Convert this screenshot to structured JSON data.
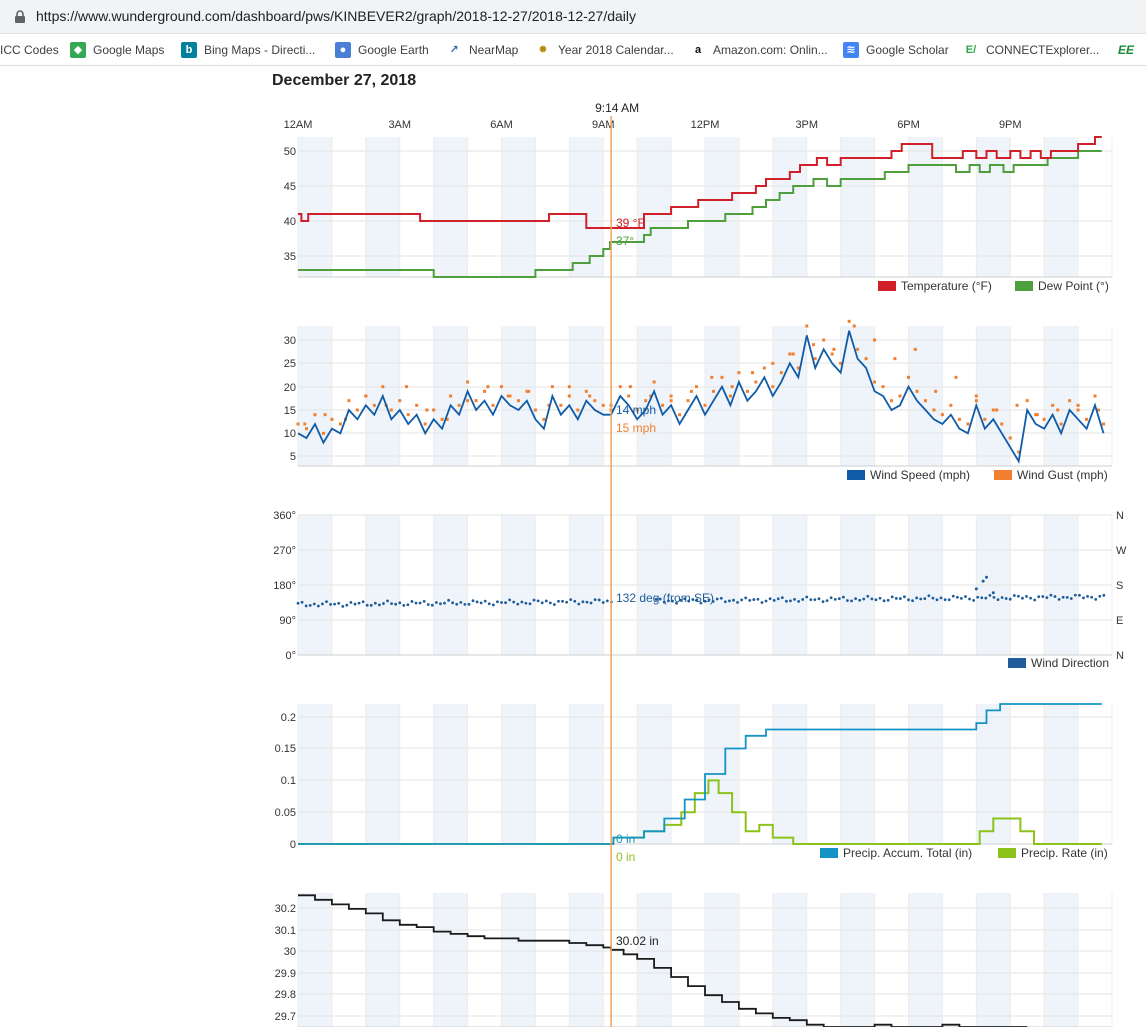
{
  "browser": {
    "url": "https://www.wunderground.com/dashboard/pws/KINBEVER2/graph/2018-12-27/2018-12-27/daily",
    "bookmarks": [
      {
        "label": "ICC Codes",
        "icon": "folder-icon"
      },
      {
        "label": "Google Maps",
        "icon": "google-maps-icon"
      },
      {
        "label": "Bing Maps - Directi...",
        "icon": "bing-icon"
      },
      {
        "label": "Google Earth",
        "icon": "google-earth-icon"
      },
      {
        "label": "NearMap",
        "icon": "nearmap-icon"
      },
      {
        "label": "Year 2018 Calendar...",
        "icon": "calendar-icon"
      },
      {
        "label": "Amazon.com: Onlin...",
        "icon": "amazon-icon"
      },
      {
        "label": "Google Scholar",
        "icon": "google-scholar-icon"
      },
      {
        "label": "CONNECTExplorer...",
        "icon": "connect-icon"
      },
      {
        "label": "EE",
        "icon": "ee-icon"
      }
    ]
  },
  "page": {
    "title": "December 27, 2018"
  },
  "cursor": {
    "label": "9:14 AM",
    "hour": 9.233
  },
  "xaxis": {
    "ticks": [
      "12AM",
      "3AM",
      "6AM",
      "9AM",
      "12PM",
      "3PM",
      "6PM",
      "9PM"
    ]
  },
  "colors": {
    "temperature": "#d0202a",
    "dewpoint": "#4fa03c",
    "wind_speed": "#0f5ba7",
    "wind_gust": "#f07f2f",
    "wind_dir": "#1f5c99",
    "accum": "#1494c6",
    "rate": "#8cc21a",
    "pressure": "#1a1a1a",
    "cursor": "#f0a35c"
  },
  "chart_data": [
    {
      "type": "line",
      "ylim": [
        32,
        52
      ],
      "yticks": [
        "50",
        "45",
        "40",
        "35"
      ],
      "series": [
        {
          "name": "Temperature (°F)",
          "x": [
            0,
            0.1,
            0.3,
            3.5,
            3.6,
            7.2,
            7.4,
            8.4,
            8.5,
            9.2,
            10.2,
            10.3,
            11,
            11.6,
            11.8,
            12.6,
            12.8,
            13.1,
            13.5,
            13.8,
            14.2,
            14.5,
            14.8,
            15.1,
            15.3,
            15.6,
            16,
            16.6,
            17.2,
            17.5,
            17.8,
            18.4,
            18.7,
            19.2,
            19.6,
            20,
            20.3,
            20.6,
            21,
            21.3,
            21.6,
            21.9,
            22.2,
            22.6,
            23,
            23.3,
            23.5,
            23.7
          ],
          "y": [
            41,
            40,
            41,
            41,
            40,
            40,
            41,
            41,
            39,
            39,
            41,
            41,
            42,
            42,
            43,
            43,
            44,
            44,
            45,
            46,
            46,
            47,
            48,
            48,
            49,
            48,
            49,
            49,
            49,
            50,
            51,
            51,
            49,
            49,
            50,
            49,
            50,
            49,
            50,
            49,
            50,
            49,
            50,
            50,
            51,
            51,
            52,
            52
          ],
          "current_label": "39 °F"
        },
        {
          "name": "Dew Point (°)",
          "x": [
            0,
            3.9,
            4.0,
            6.8,
            7.0,
            8.0,
            8.1,
            8.4,
            8.6,
            9.0,
            9.2,
            10.2,
            10.4,
            11,
            11.5,
            12.4,
            12.6,
            13.1,
            13.4,
            13.8,
            14.2,
            14.6,
            14.8,
            15.2,
            15.6,
            16,
            16.5,
            17.0,
            17.3,
            17.6,
            18.0,
            18.7,
            19.4,
            19.6,
            19.8,
            20.1,
            20.4,
            20.8,
            21.1,
            21.6,
            22.1,
            22.6,
            23,
            23.3,
            23.7
          ],
          "y": [
            33,
            33,
            32,
            32,
            33,
            33,
            34,
            34,
            35,
            36,
            37,
            38,
            39,
            39,
            40,
            40,
            41,
            41,
            42,
            43,
            44,
            45,
            45,
            46,
            45,
            46,
            46,
            46,
            47,
            47,
            48,
            48,
            47,
            47,
            48,
            47,
            48,
            47,
            48,
            48,
            49,
            49,
            50,
            50,
            50
          ],
          "current_label": "37°"
        }
      ]
    },
    {
      "type": "line",
      "ylim": [
        3,
        33
      ],
      "yticks": [
        "30",
        "25",
        "20",
        "15",
        "10",
        "5"
      ],
      "series": [
        {
          "name": "Wind Speed (mph)",
          "x": [
            0,
            0.25,
            0.5,
            0.75,
            1,
            1.25,
            1.5,
            1.75,
            2,
            2.25,
            2.5,
            2.75,
            3,
            3.25,
            3.5,
            3.75,
            4,
            4.25,
            4.5,
            4.75,
            5,
            5.25,
            5.5,
            5.75,
            6,
            6.25,
            6.5,
            6.75,
            7,
            7.25,
            7.5,
            7.75,
            8,
            8.25,
            8.5,
            8.75,
            9,
            9.23,
            9.5,
            9.75,
            10,
            10.25,
            10.5,
            10.75,
            11,
            11.25,
            11.5,
            11.75,
            12,
            12.25,
            12.5,
            12.75,
            13,
            13.25,
            13.5,
            13.75,
            14,
            14.25,
            14.5,
            14.75,
            15,
            15.25,
            15.5,
            15.75,
            16,
            16.25,
            16.5,
            16.75,
            17,
            17.25,
            17.5,
            17.75,
            18,
            18.25,
            18.5,
            18.75,
            19,
            19.25,
            19.5,
            19.75,
            20,
            20.25,
            20.5,
            20.75,
            21,
            21.25,
            21.5,
            21.75,
            22,
            22.25,
            22.5,
            22.75,
            23,
            23.25,
            23.5,
            23.75
          ],
          "y": [
            10,
            9,
            12,
            8,
            11,
            10,
            15,
            13,
            16,
            14,
            18,
            13,
            15,
            12,
            14,
            10,
            13,
            11,
            16,
            14,
            19,
            15,
            17,
            14,
            18,
            16,
            15,
            17,
            13,
            11,
            18,
            14,
            16,
            13,
            17,
            15,
            14,
            14,
            18,
            16,
            13,
            15,
            19,
            14,
            16,
            12,
            15,
            18,
            14,
            17,
            20,
            16,
            21,
            17,
            19,
            22,
            18,
            21,
            25,
            22,
            31,
            24,
            28,
            25,
            23,
            32,
            26,
            24,
            19,
            18,
            15,
            16,
            20,
            17,
            15,
            13,
            12,
            14,
            11,
            10,
            16,
            11,
            13,
            10,
            7,
            4,
            15,
            12,
            11,
            14,
            10,
            15,
            13,
            11,
            16,
            10
          ],
          "current_label": "14 mph"
        },
        {
          "name": "Wind Gust (mph)",
          "x": [
            0.2,
            0.8,
            1.4,
            2.0,
            2.6,
            3.2,
            3.8,
            4.4,
            5.0,
            5.6,
            6.2,
            6.8,
            7.4,
            8.0,
            8.6,
            9.23,
            9.8,
            10.4,
            11.0,
            11.6,
            12.2,
            12.8,
            13.4,
            14.0,
            14.6,
            15.2,
            15.8,
            16.4,
            17.0,
            17.6,
            18.2,
            18.8,
            19.4,
            20.0,
            20.6,
            21.2,
            21.8,
            22.4,
            23.0,
            23.6
          ],
          "y": [
            12,
            14,
            13,
            18,
            16,
            20,
            15,
            13,
            17,
            20,
            18,
            19,
            16,
            20,
            18,
            15,
            20,
            18,
            17,
            19,
            22,
            20,
            23,
            25,
            27,
            29,
            28,
            33,
            30,
            26,
            28,
            19,
            22,
            17,
            15,
            16,
            14,
            15,
            16,
            15
          ],
          "current_label": "15 mph"
        }
      ]
    },
    {
      "type": "scatter",
      "ylim": [
        0,
        360
      ],
      "yticks": [
        "360°",
        "270°",
        "180°",
        "90°",
        "0°"
      ],
      "right_ticks": [
        "N",
        "W",
        "S",
        "E",
        "N"
      ],
      "series": [
        {
          "name": "Wind Direction",
          "baseline_start": 130,
          "baseline_end": 150,
          "gap": [
            9.3,
            10.5
          ],
          "spike": {
            "x": [
              20.0,
              20.2,
              20.3,
              20.5
            ],
            "y": [
              170,
              190,
              200,
              160
            ]
          },
          "current_label": "132 deg (from SE)"
        }
      ]
    },
    {
      "type": "line",
      "ylim": [
        0,
        0.22
      ],
      "yticks": [
        "0.2",
        "0.15",
        "0.1",
        "0.05",
        "0"
      ],
      "series": [
        {
          "name": "Precip. Accum. Total (in)",
          "x": [
            0,
            9.23,
            9.3,
            10.2,
            10.8,
            11.4,
            12.0,
            12.6,
            13.2,
            13.8,
            14.4,
            19.7,
            20.0,
            20.3,
            20.7,
            23.7
          ],
          "y": [
            0,
            0,
            0.01,
            0.02,
            0.04,
            0.07,
            0.11,
            0.15,
            0.17,
            0.18,
            0.18,
            0.18,
            0.19,
            0.21,
            0.22,
            0.22
          ],
          "current_label": "0 in"
        },
        {
          "name": "Precip. Rate (in)",
          "x": [
            0,
            9.23,
            9.3,
            10.2,
            10.8,
            11.3,
            11.7,
            12.1,
            12.4,
            12.8,
            13.2,
            13.6,
            14.0,
            14.6,
            19.7,
            20.1,
            20.5,
            20.9,
            21.3,
            21.7,
            23.7
          ],
          "y": [
            0,
            0,
            0.01,
            0.02,
            0.03,
            0.05,
            0.08,
            0.1,
            0.08,
            0.05,
            0.02,
            0.03,
            0.01,
            0,
            0,
            0.02,
            0.04,
            0.04,
            0.02,
            0,
            0
          ],
          "current_label": "0 in"
        }
      ]
    },
    {
      "type": "line",
      "ylim": [
        29.68,
        30.27
      ],
      "yticks": [
        "30.2",
        "30.1",
        "30",
        "29.9",
        "29.8",
        "29.7"
      ],
      "series": [
        {
          "x": [
            0,
            0.5,
            1,
            1.5,
            2,
            2.5,
            3,
            3.5,
            4,
            4.5,
            5,
            5.5,
            6,
            6.5,
            7,
            7.5,
            8,
            8.5,
            9,
            9.23,
            9.6,
            10,
            10.5,
            11,
            11.5,
            12,
            12.5,
            13,
            13.5,
            14,
            14.5,
            15,
            15.5,
            16,
            16.5,
            17,
            17.5,
            18,
            18.5,
            19,
            19.5,
            20,
            20.5,
            21,
            21.5
          ],
          "y": [
            30.26,
            30.24,
            30.22,
            30.2,
            30.18,
            30.15,
            30.13,
            30.12,
            30.1,
            30.09,
            30.08,
            30.07,
            30.07,
            30.06,
            30.06,
            30.06,
            30.05,
            30.04,
            30.03,
            30.02,
            30.0,
            29.98,
            29.94,
            29.9,
            29.86,
            29.82,
            29.79,
            29.76,
            29.74,
            29.72,
            29.71,
            29.69,
            29.68,
            29.68,
            29.68,
            29.69,
            29.68,
            29.68,
            29.68,
            29.69,
            29.68,
            29.68,
            29.68,
            29.68,
            29.68
          ],
          "current_label": "30.02 in"
        }
      ]
    }
  ]
}
